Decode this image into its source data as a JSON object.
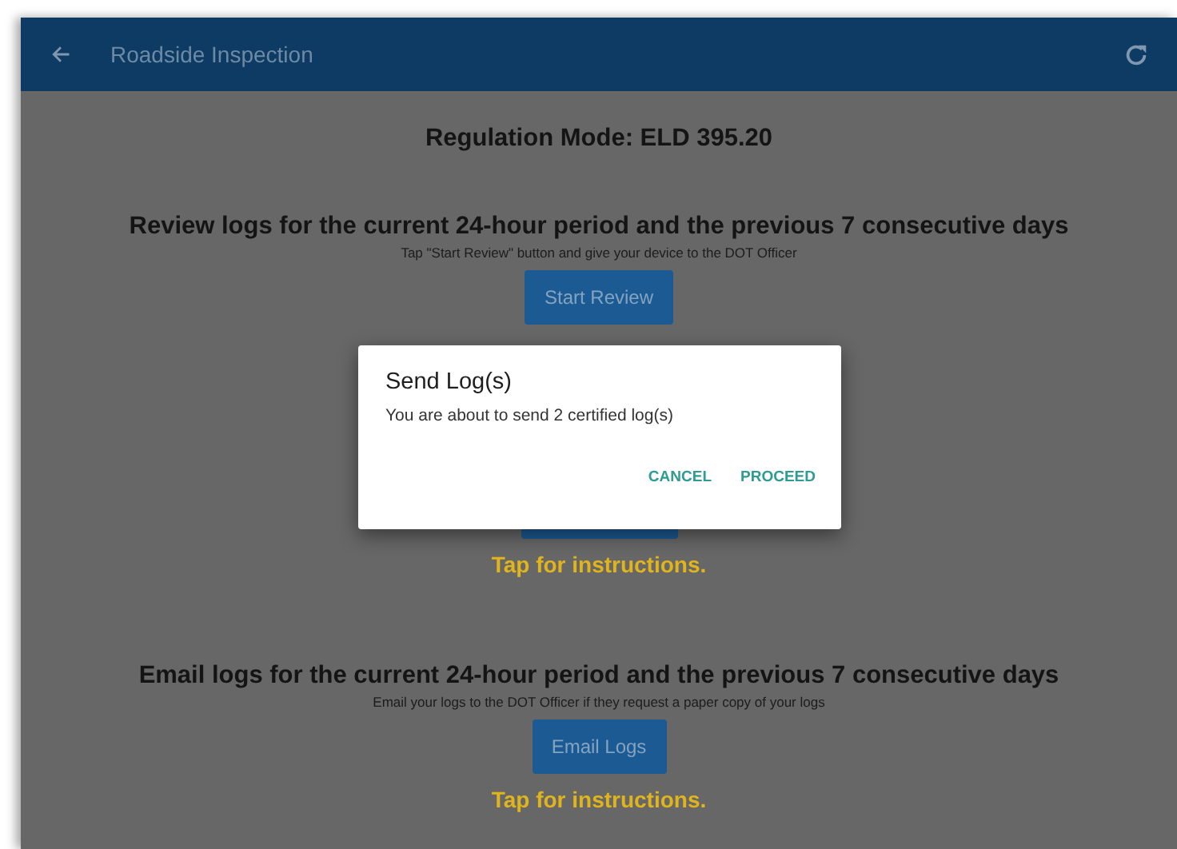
{
  "app_bar": {
    "title": "Roadside Inspection"
  },
  "regulation_mode": "Regulation Mode: ELD 395.20",
  "sections": [
    {
      "kind": "full",
      "heading": "Review logs for the current 24-hour period and the previous 7 consecutive days",
      "description": "Tap \"Start Review\" button and give your device to the DOT Officer",
      "button": "Start Review"
    },
    {
      "kind": "covered",
      "instructions": "Tap for instructions."
    },
    {
      "kind": "full",
      "heading": "Email logs for the current 24-hour period and the previous 7 consecutive days",
      "description": "Email your logs to the DOT Officer if they request a paper copy of your logs",
      "button": "Email Logs",
      "instructions": "Tap for instructions."
    }
  ],
  "dialog": {
    "title": "Send Log(s)",
    "message": "You are about to send 2 certified log(s)",
    "actions": [
      "CANCEL",
      "PROCEED"
    ]
  }
}
